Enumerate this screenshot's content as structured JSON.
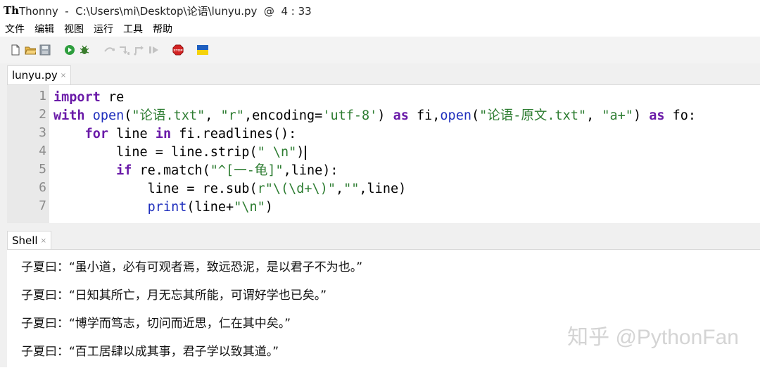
{
  "window": {
    "logo_text": "Th",
    "title": "Thonny  -  C:\\Users\\mi\\Desktop\\论语\\lunyu.py  @  4 : 33"
  },
  "menu": [
    "文件",
    "编辑",
    "视图",
    "运行",
    "工具",
    "帮助"
  ],
  "toolbar": {
    "icons": [
      "new-file-icon",
      "open-file-icon",
      "save-icon",
      "run-icon",
      "debug-icon",
      "step-over-icon",
      "step-into-icon",
      "step-out-icon",
      "resume-icon",
      "stop-icon",
      "ukraine-flag-icon"
    ],
    "stop_label": "STOP",
    "colors": {
      "run": "#2e9e3e",
      "stop": "#d32222",
      "flag_blue": "#1f5fbf",
      "flag_yellow": "#f5d20a"
    }
  },
  "editor": {
    "tab_label": "lunyu.py",
    "tab_close": "×",
    "line_numbers": [
      "1",
      "2",
      "3",
      "4",
      "5",
      "6",
      "7"
    ],
    "lines": [
      "import re",
      "with open(\"论语.txt\", \"r\",encoding='utf-8') as fi,open(\"论语-原文.txt\", \"a+\") as fo:",
      "    for line in fi.readlines():",
      "        line = line.strip(\" \\n\")",
      "        if re.match(\"^[一-龟]\",line):",
      "            line = re.sub(r\"\\(\\d+\\)\",\"\",line)",
      "            print(line+\"\\n\")"
    ],
    "syntax_colors": {
      "keyword": "#6a1aa8",
      "string": "#2e7d32",
      "builtin": "#1f2fbd"
    }
  },
  "shell": {
    "tab_label": "Shell",
    "tab_close": "×",
    "lines": [
      "子夏曰：“虽小道，必有可观者焉，致远恐泥，是以君子不为也。”",
      "子夏曰：“日知其所亡，月无忘其所能，可谓好学也已矣。”",
      "子夏曰：“博学而笃志，切问而近思，仁在其中矣。”",
      "子夏曰：“百工居肆以成其事，君子学以致其道。”"
    ]
  },
  "watermark": "知乎 @PythonFan"
}
